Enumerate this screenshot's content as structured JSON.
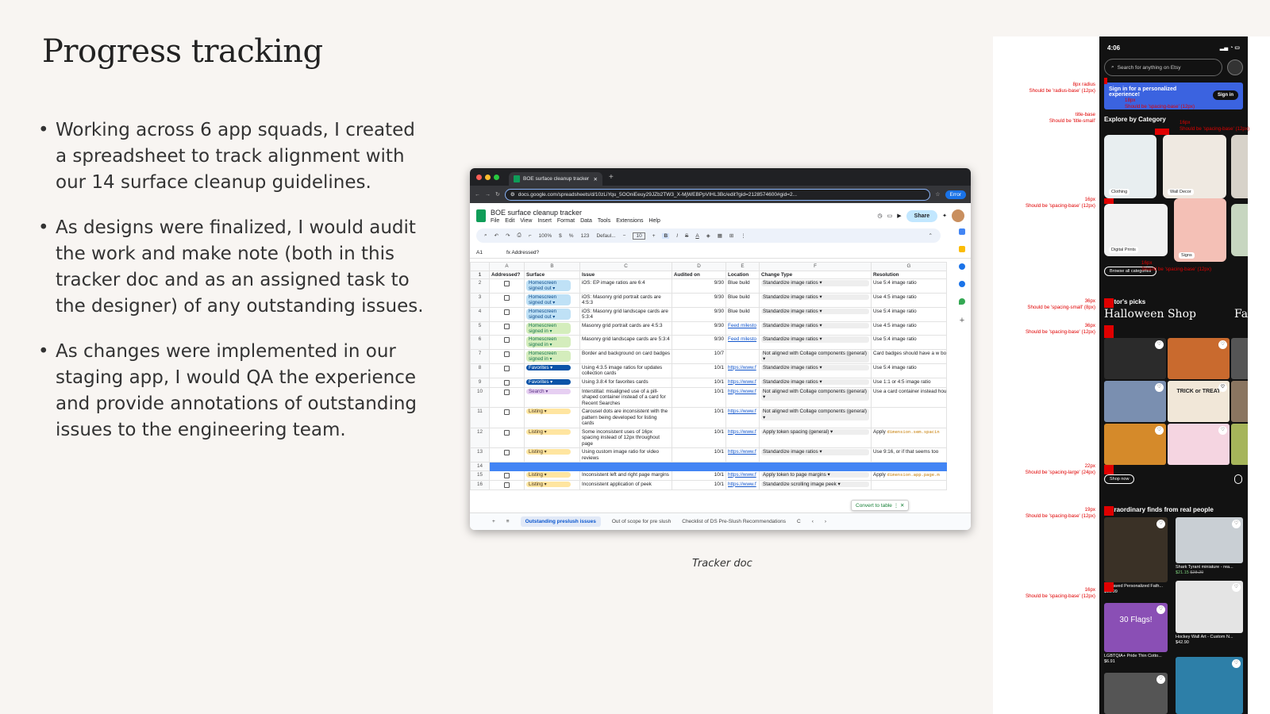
{
  "slide": {
    "title": "Progress tracking",
    "bullets": [
      "Working across 6 app squads, I created a spreadsheet to track alignment with our 14 surface cleanup guidelines.",
      "As designs were finalized, I would audit the work and make note (both in this tracker doc and as an assigned task to the designer) of any outstanding issues.",
      "As changes were implemented in our staging app, I would QA the experience and provide annotations of outstanding issues to the engineering team."
    ],
    "bullet_char": "•",
    "caption": "Tracker doc"
  },
  "browser": {
    "tab_title": "BOE surface cleanup tracker",
    "url": "docs.google.com/spreadsheets/d/10zLiYqu_5OOniEeuy29JZb2TW3_X-MjWEBPpVIHL3Bc/edit?gid=2128574600#gid=2...",
    "error_label": "Error"
  },
  "sheet": {
    "title": "BOE surface cleanup tracker",
    "menus": [
      "File",
      "Edit",
      "View",
      "Insert",
      "Format",
      "Data",
      "Tools",
      "Extensions",
      "Help"
    ],
    "share_label": "Share",
    "toolbar": {
      "zoom": "100%",
      "currency": "$",
      "percent": "%",
      "format_123": "123",
      "font": "Defaul...",
      "font_size": "10"
    },
    "cell_ref": "A1",
    "formula": "Addressed?",
    "col_letters": [
      "A",
      "B",
      "C",
      "D",
      "E",
      "F",
      "G"
    ],
    "headers": [
      "Addressed?",
      "Surface",
      "Issue",
      "Audited on",
      "Location",
      "Change Type",
      "Resolution"
    ],
    "rows": [
      {
        "n": "2",
        "surface": "Homescreen signed out",
        "color": "blue",
        "issue": "iOS: EP image ratios are 6:4",
        "date": "9/30",
        "loc": "Blue build",
        "link": false,
        "change": "Standardize image ratios",
        "res": "Use 5:4 image ratio",
        "code": false
      },
      {
        "n": "3",
        "surface": "Homescreen signed out",
        "color": "blue",
        "issue": "iOS: Masonry grid portrait cards are 4:5:3",
        "date": "9/30",
        "loc": "Blue build",
        "link": false,
        "change": "Standardize image ratios",
        "res": "Use 4:5 image ratio",
        "code": false
      },
      {
        "n": "4",
        "surface": "Homescreen signed out",
        "color": "blue",
        "issue": "iOS: Masonry grid landscape cards are 5:3:4",
        "date": "9/30",
        "loc": "Blue build",
        "link": false,
        "change": "Standardize image ratios",
        "res": "Use 5:4 image ratio",
        "code": false
      },
      {
        "n": "5",
        "surface": "Homescreen signed in",
        "color": "green",
        "issue": "Masonry grid portrait cards are 4:5:3",
        "date": "9/30",
        "loc": "Feed milesto",
        "link": true,
        "change": "Standardize image ratios",
        "res": "Use 4:5 image ratio",
        "code": false
      },
      {
        "n": "6",
        "surface": "Homescreen signed in",
        "color": "green",
        "issue": "Masonry grid landscape cards are 5:3:4",
        "date": "9/30",
        "loc": "Feed milesto",
        "link": true,
        "change": "Standardize image ratios",
        "res": "Use 5:4 image ratio",
        "code": false
      },
      {
        "n": "7",
        "surface": "Homescreen signed in",
        "color": "green",
        "issue": "Border and background on card badges",
        "date": "10/7",
        "loc": "",
        "link": false,
        "change": "Not aligned with Collage components (general)",
        "res": "Card badges should have a w border",
        "code": false
      },
      {
        "n": "8",
        "surface": "Favorites",
        "color": "navy",
        "issue": "Using 4:3.5 image ratios for updates collection cards",
        "date": "10/1",
        "loc": "https://www.f",
        "link": true,
        "change": "Standardize image ratios",
        "res": "Use 5:4 image ratio",
        "code": false
      },
      {
        "n": "9",
        "surface": "Favorites",
        "color": "navy",
        "issue": "Using 3.8:4 for favorites cards",
        "date": "10/1",
        "loc": "https://www.f",
        "link": true,
        "change": "Standardize image ratios",
        "res": "Use 1:1 or 4:5 image ratio",
        "code": false
      },
      {
        "n": "10",
        "surface": "Search",
        "color": "purple",
        "issue": "Interstitial: misaligned use of a pill-shaped container instead of a card for Recent Searches",
        "date": "10/1",
        "loc": "https://www.f",
        "link": true,
        "change": "Not aligned with Collage components (general)",
        "res": "Use a card container instead housing images and multiple l",
        "code": false
      },
      {
        "n": "11",
        "surface": "Listing",
        "color": "yellow",
        "issue": "Carousel dots are inconsistent with the pattern being developed for listing cards",
        "date": "10/1",
        "loc": "https://www.f",
        "link": true,
        "change": "Not aligned with Collage components (general)",
        "res": "",
        "code": false
      },
      {
        "n": "12",
        "surface": "Listing",
        "color": "yellow",
        "issue": "Some inconsistent uses of 16px spacing instead of 12px throughout page",
        "date": "10/1",
        "loc": "https://www.f",
        "link": true,
        "change": "Apply token spacing (general)",
        "res": "Apply",
        "code": "dimension.sem.spacin"
      },
      {
        "n": "13",
        "surface": "Listing",
        "color": "yellow",
        "issue": "Using custom image ratio for video reviews",
        "date": "10/1",
        "loc": "https://www.f",
        "link": true,
        "change": "Standardize image ratios",
        "res": "Use 9:16, or if that seems too",
        "code": false
      },
      {
        "n": "14",
        "surface": "",
        "color": "",
        "issue": "",
        "date": "",
        "loc": "",
        "link": false,
        "change": "",
        "res": "",
        "code": false
      },
      {
        "n": "15",
        "surface": "Listing",
        "color": "yellow",
        "issue": "Inconsistent left and right page margins",
        "date": "10/1",
        "loc": "https://www.f",
        "link": true,
        "change": "Apply token to page margins",
        "res": "Apply",
        "code": "dimension.app.page.m"
      },
      {
        "n": "16",
        "surface": "Listing",
        "color": "yellow",
        "issue": "Inconsistent application of peek",
        "date": "10/1",
        "loc": "https://www.f",
        "link": true,
        "change": "Standardize scrolling image peek",
        "res": "",
        "code": false
      }
    ],
    "convert_label": "Convert to table",
    "sheet_tabs": [
      "Outstanding preslush issues",
      "Out of scope for pre slush",
      "Checklist of DS Pre-Slush Recommendations",
      "C"
    ]
  },
  "phone": {
    "time": "4:06",
    "search_placeholder": "Search for anything on Etsy",
    "signin_text": "Sign in for a personalized experience!",
    "signin_button": "Sign in",
    "explore_title": "Explore by Category",
    "categories": [
      "Clothing",
      "Wall Decor",
      "Digital Prints",
      "Signs"
    ],
    "browse_all": "Browse all categories",
    "editors_picks": "Editor's picks",
    "halloween": "Halloween Shop",
    "fal": "Fal",
    "shop_now": "Shop now",
    "extraordinary": "Extraordinary finds from real people",
    "products": [
      {
        "name": "Engraved Personalized Fath...",
        "price": "$13.99"
      },
      {
        "name": "Shark Tyrant miniature - rea...",
        "price": "$21.15",
        "old": "$28.20"
      },
      {
        "name": "LGBTQIA+ Pride Thin Cotto...",
        "price": "$6.91"
      },
      {
        "name": "Hockey Wall Art - Custom N...",
        "price": "$42.90"
      }
    ],
    "tile_text": [
      "TRICK or TREAT",
      "30 Flags!"
    ]
  },
  "annotations": [
    {
      "a": "8px radius",
      "b": "Should be 'radius-base' (12px)"
    },
    {
      "a": "title-base",
      "b": "Should be 'title-small'"
    },
    {
      "a": "16px",
      "b": "Should be 'spacing-base' (12px)"
    },
    {
      "a": "36px",
      "b": "Should be 'spacing-small' (8px)"
    },
    {
      "a": "36px",
      "b": "Should be 'spacing-base' (12px)"
    },
    {
      "a": "22px",
      "b": "Should be 'spacing-large' (24px)"
    },
    {
      "a": "19px",
      "b": "Should be 'spacing-base' (12px)"
    },
    {
      "a": "16px",
      "b": "Should be 'spacing-base' (12px)"
    }
  ],
  "inline_annotations": [
    {
      "a": "16px",
      "b": "Should be 'spacing-base' (12px)"
    },
    {
      "a": "18px",
      "b": "Should be 'spacing-base' (12px)"
    },
    {
      "a": "16px",
      "b": "Should be 'spacing-base' (12px)"
    }
  ],
  "colors": {
    "annotation_red": "#e00000",
    "sheets_green": "#0f9d58",
    "signin_blue": "#3b63e0",
    "selected_row": "#4285f4"
  }
}
